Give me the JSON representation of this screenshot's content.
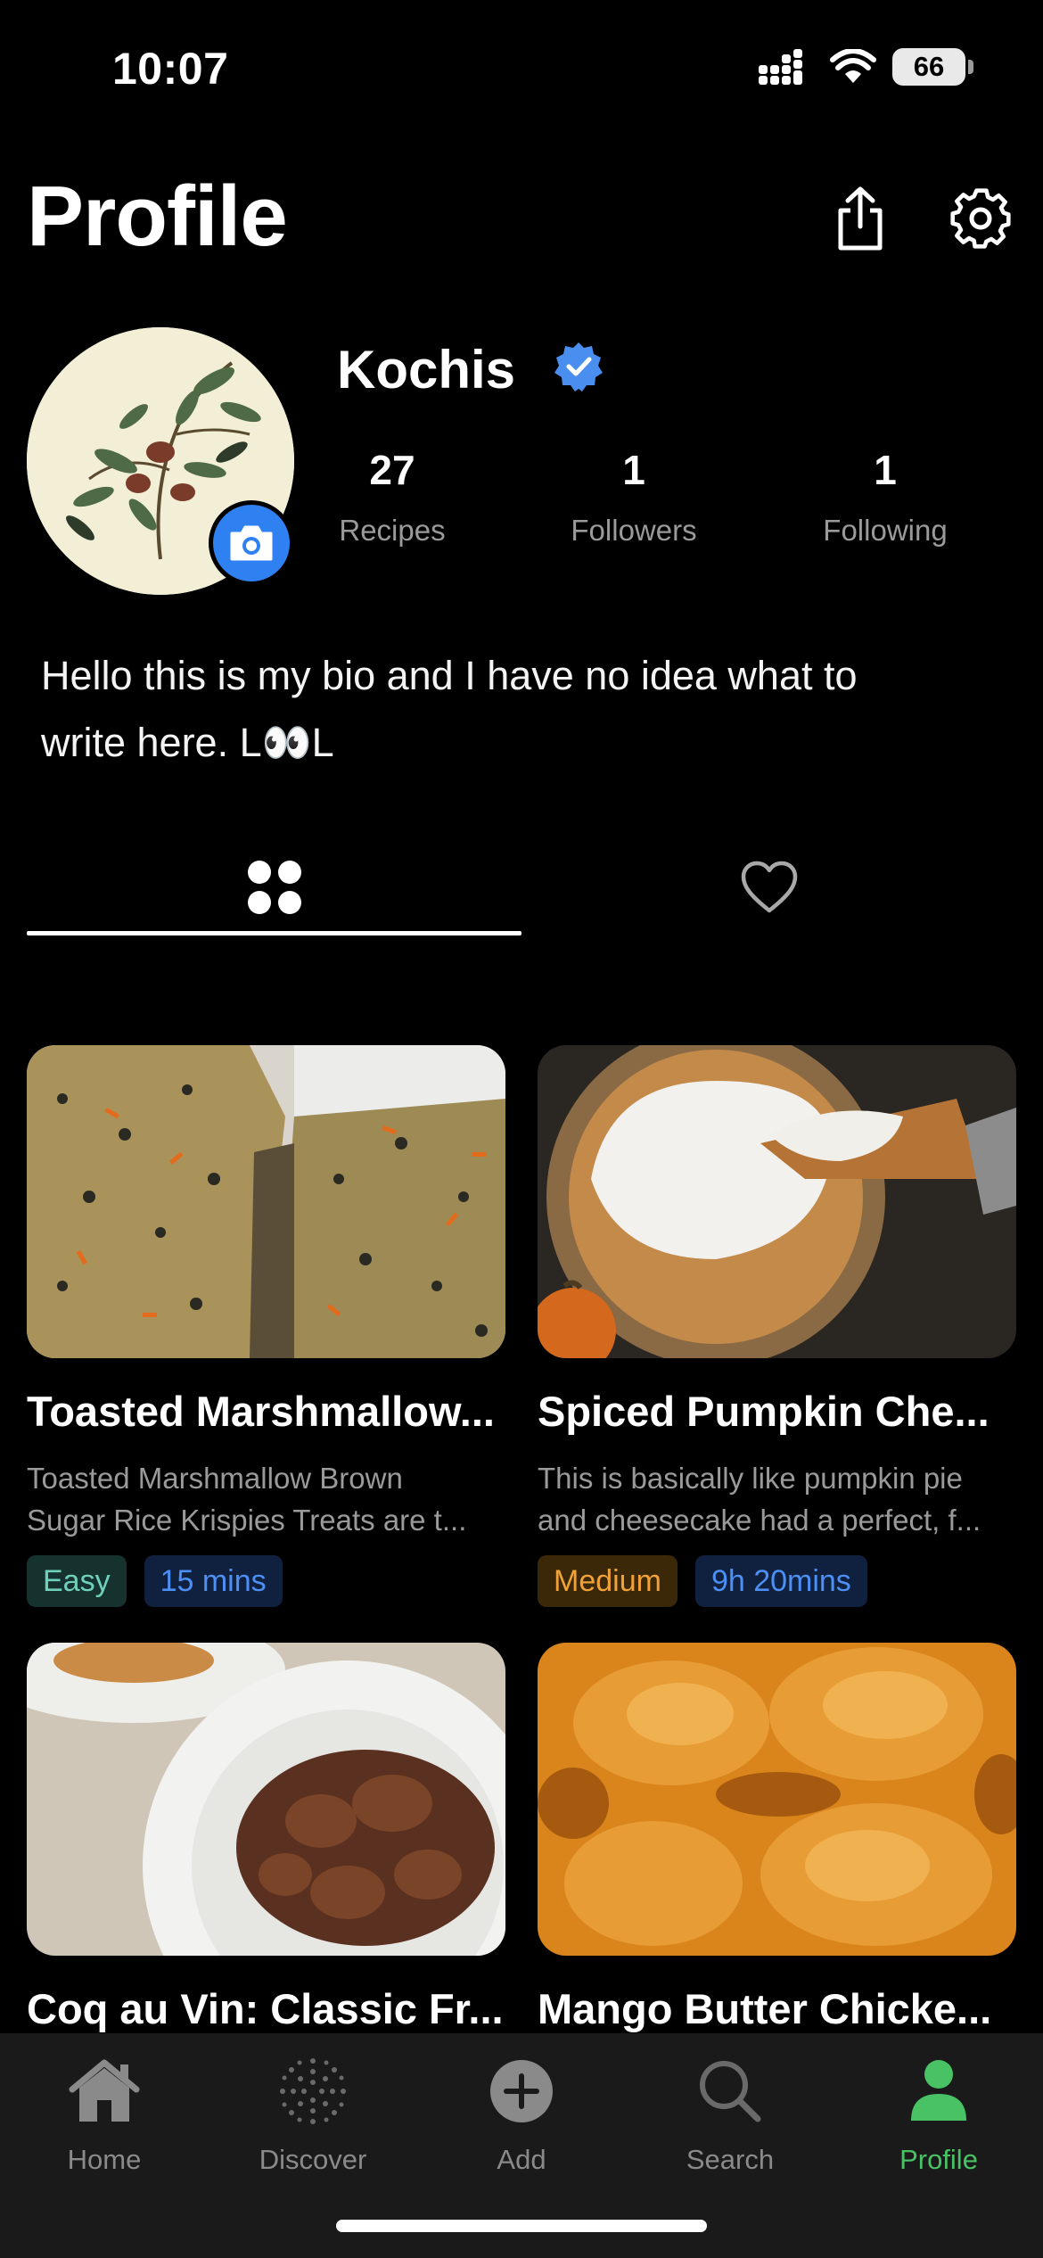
{
  "status_bar": {
    "time": "10:07",
    "battery": "66"
  },
  "header": {
    "title": "Profile"
  },
  "profile": {
    "username": "Kochis",
    "stats": [
      {
        "value": "27",
        "label": "Recipes"
      },
      {
        "value": "1",
        "label": "Followers"
      },
      {
        "value": "1",
        "label": "Following"
      }
    ],
    "bio_line1": "Hello this is my bio and I have no idea what to",
    "bio_line2": "write here. L👀L"
  },
  "recipes": [
    {
      "title": "Toasted Marshmallow...",
      "desc_line1": "Toasted Marshmallow Brown",
      "desc_line2": "Sugar Rice Krispies Treats are t...",
      "difficulty": "Easy",
      "time": "15 mins"
    },
    {
      "title": "Spiced Pumpkin Che...",
      "desc_line1": "This is basically like pumpkin pie",
      "desc_line2": "and cheesecake had a perfect, f...",
      "difficulty": "Medium",
      "time": "9h 20mins"
    },
    {
      "title": "Coq au Vin: Classic Fr..."
    },
    {
      "title": "Mango Butter Chicke..."
    }
  ],
  "nav": {
    "items": [
      {
        "label": "Home"
      },
      {
        "label": "Discover"
      },
      {
        "label": "Add"
      },
      {
        "label": "Search"
      },
      {
        "label": "Profile"
      }
    ]
  },
  "colors": {
    "accent_blue": "#2f80f0",
    "active_green": "#48c264",
    "easy": "#6fd1b9",
    "medium": "#f0a238",
    "time": "#4c8ff5"
  }
}
